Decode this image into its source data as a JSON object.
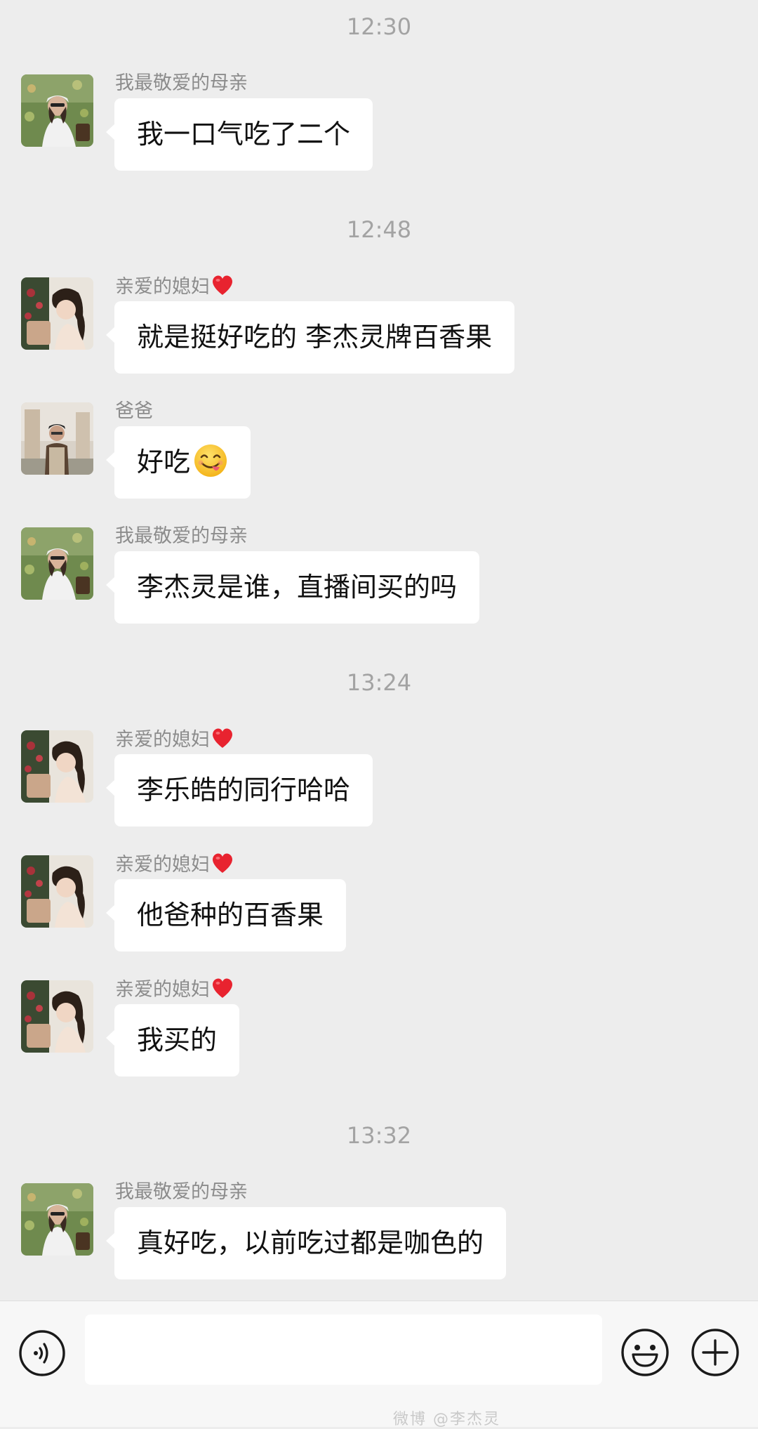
{
  "chat": {
    "timestamps": [
      "12:30",
      "12:48",
      "13:24",
      "13:32"
    ],
    "messages": [
      {
        "sender": "我最敬爱的母亲",
        "text": "我一口气吃了二个"
      },
      {
        "sender": "亲爱的媳妇",
        "text": "就是挺好吃的  李杰灵牌百香果"
      },
      {
        "sender": "爸爸",
        "text": "好吃"
      },
      {
        "sender": "我最敬爱的母亲",
        "text": "李杰灵是谁，直播间买的吗"
      },
      {
        "sender": "亲爱的媳妇",
        "text": "李乐皓的同行哈哈"
      },
      {
        "sender": "亲爱的媳妇",
        "text": "他爸种的百香果"
      },
      {
        "sender": "亲爱的媳妇",
        "text": "我买的"
      },
      {
        "sender": "我最敬爱的母亲",
        "text": "真好吃，以前吃过都是咖色的"
      }
    ]
  },
  "input_bar": {
    "input_value": "",
    "voice_icon": "voice-icon",
    "emoji_icon": "emoji-icon",
    "plus_icon": "plus-icon",
    "watermark": "微博 @李杰灵"
  },
  "colors": {
    "background": "#ededed",
    "bubble": "#ffffff",
    "timestamp": "#a3a3a3",
    "sender_name": "#8c8c8c",
    "heart": "#e8232f"
  }
}
